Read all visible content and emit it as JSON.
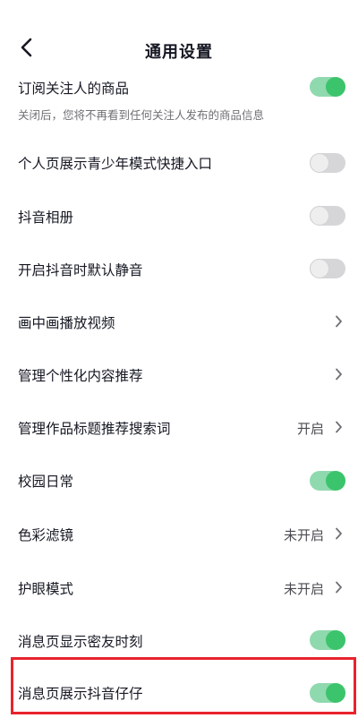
{
  "header": {
    "title": "通用设置"
  },
  "settings": [
    {
      "label": "订阅关注人的商品",
      "sub": "关闭后，您将不再看到任何关注人发布的商品信息",
      "control": "toggle",
      "on": true
    },
    {
      "label": "个人页展示青少年模式快捷入口",
      "control": "toggle",
      "on": false
    },
    {
      "label": "抖音相册",
      "control": "toggle",
      "on": false
    },
    {
      "label": "开启抖音时默认静音",
      "control": "toggle",
      "on": false
    },
    {
      "label": "画中画播放视频",
      "control": "link",
      "value": ""
    },
    {
      "label": "管理个性化内容推荐",
      "control": "link",
      "value": ""
    },
    {
      "label": "管理作品标题推荐搜索词",
      "control": "link",
      "value": "开启"
    },
    {
      "label": "校园日常",
      "control": "toggle",
      "on": true
    },
    {
      "label": "色彩滤镜",
      "control": "link",
      "value": "未开启"
    },
    {
      "label": "护眼模式",
      "control": "link",
      "value": "未开启"
    },
    {
      "label": "消息页显示密友时刻",
      "control": "toggle",
      "on": true
    },
    {
      "label": "消息页展示抖音仔仔",
      "control": "toggle",
      "on": true
    }
  ],
  "colors": {
    "toggle_on_track": "#8fd9ae",
    "toggle_on_knob": "#3cc46c",
    "highlight": "#e8232e"
  }
}
